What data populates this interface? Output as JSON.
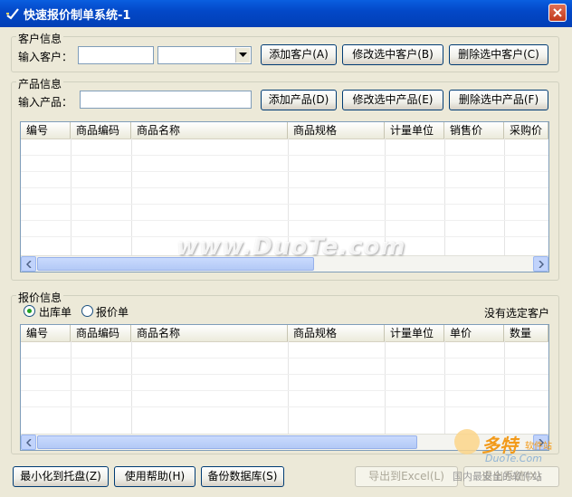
{
  "window": {
    "title": "快速报价制单系统-1"
  },
  "customer": {
    "group_title": "客户信息",
    "input_label": "输入客户：",
    "input_value": "",
    "combo_value": "",
    "btn_add": "添加客户(A)",
    "btn_edit": "修改选中客户(B)",
    "btn_delete": "删除选中客户(C)"
  },
  "product": {
    "group_title": "产品信息",
    "input_label": "输入产品：",
    "input_value": "",
    "btn_add": "添加产品(D)",
    "btn_edit": "修改选中产品(E)",
    "btn_delete": "删除选中产品(F)",
    "columns": [
      "编号",
      "商品编码",
      "商品名称",
      "商品规格",
      "计量单位",
      "销售价",
      "采购价"
    ]
  },
  "quote": {
    "group_title": "报价信息",
    "radio_outbound": "出库单",
    "radio_quote": "报价单",
    "selected": "outbound",
    "status": "没有选定客户",
    "columns": [
      "编号",
      "商品编码",
      "商品名称",
      "商品规格",
      "计量单位",
      "单价",
      "数量"
    ]
  },
  "footer": {
    "btn_minimize": "最小化到托盘(Z)",
    "btn_help": "使用帮助(H)",
    "btn_backup": "备份数据库(S)",
    "btn_export": "导出到Excel(L)",
    "btn_exit": "退出系统(X)"
  },
  "watermarks": {
    "center": "www.DuoTe.com",
    "logo_brand": "多特",
    "logo_tag": "软件站",
    "logo_sub": "DuoTe.Com",
    "logo_tagline": "国内最安全的软件站"
  }
}
